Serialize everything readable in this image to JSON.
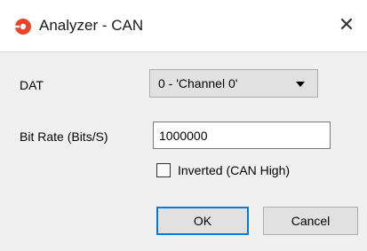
{
  "window": {
    "title": "Analyzer - CAN",
    "app_icon": "analyzer-logo-icon",
    "close_icon": "close-icon",
    "close_glyph": "✕"
  },
  "form": {
    "dat_label": "DAT",
    "dat_value": "0 - 'Channel 0'",
    "bitrate_label": "Bit Rate (Bits/S)",
    "bitrate_value": "1000000",
    "inverted_label": "Inverted (CAN High)",
    "inverted_checked": false
  },
  "buttons": {
    "ok_label": "OK",
    "cancel_label": "Cancel"
  },
  "colors": {
    "accent": "#0078d7",
    "app_icon": "#e8462a"
  }
}
